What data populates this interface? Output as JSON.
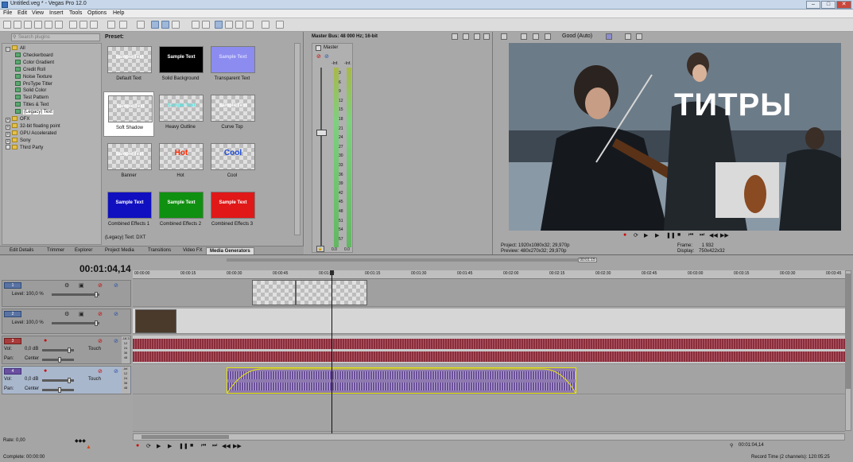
{
  "window": {
    "title": "Untitled.veg * - Vegas Pro 12.0",
    "controls": [
      "–",
      "□",
      "✕"
    ]
  },
  "menu": [
    "File",
    "Edit",
    "View",
    "Insert",
    "Tools",
    "Options",
    "Help"
  ],
  "explorer": {
    "search_placeholder": "Search plugins",
    "tree": [
      {
        "label": "All",
        "level": 0,
        "kind": "folder",
        "expander": "−"
      },
      {
        "label": "Checkerboard",
        "level": 1,
        "kind": "gen"
      },
      {
        "label": "Color Gradient",
        "level": 1,
        "kind": "gen"
      },
      {
        "label": "Credit Roll",
        "level": 1,
        "kind": "gen"
      },
      {
        "label": "Noise Texture",
        "level": 1,
        "kind": "gen"
      },
      {
        "label": "ProType Titler",
        "level": 1,
        "kind": "gen"
      },
      {
        "label": "Solid Color",
        "level": 1,
        "kind": "gen"
      },
      {
        "label": "Test Pattern",
        "level": 1,
        "kind": "gen"
      },
      {
        "label": "Titles & Text",
        "level": 1,
        "kind": "gen"
      },
      {
        "label": "(Legacy) Text",
        "level": 1,
        "kind": "gen",
        "selected": true
      },
      {
        "label": "OFX",
        "level": 0,
        "kind": "folder",
        "expander": "+"
      },
      {
        "label": "32-bit floating point",
        "level": 0,
        "kind": "folder",
        "expander": "+"
      },
      {
        "label": "GPU Accelerated",
        "level": 0,
        "kind": "folder",
        "expander": "+"
      },
      {
        "label": "Sony",
        "level": 0,
        "kind": "folder",
        "expander": "+"
      },
      {
        "label": "Third Party",
        "level": 0,
        "kind": "folder",
        "expander": ""
      }
    ],
    "preset_heading": "Preset:",
    "presets": [
      {
        "name": "Default Text",
        "thumb_text": "Sample Text",
        "bg": "checker",
        "fg": "#ffffff"
      },
      {
        "name": "Solid Background",
        "thumb_text": "Sample Text",
        "bg": "#000000",
        "fg": "#ffffff"
      },
      {
        "name": "Transparent Text",
        "thumb_text": "Sample Text",
        "bg": "#8c8cf0",
        "fg": "#d8d8ff"
      },
      {
        "name": "Soft Shadow",
        "thumb_text": "Sample Text",
        "bg": "checker",
        "fg": "#ffffff",
        "selected": true
      },
      {
        "name": "Heavy Outline",
        "thumb_text": "Sample Text",
        "bg": "checker",
        "fg": "#54e3e3"
      },
      {
        "name": "Curve Top",
        "thumb_text": "Sample Text",
        "bg": "checker",
        "fg": "#ffffff"
      },
      {
        "name": "Banner",
        "thumb_text": "Sample Text",
        "bg": "checker",
        "fg": "#ffffff"
      },
      {
        "name": "Hot",
        "thumb_text": "Hot",
        "bg": "checker",
        "fg": "#ff2a00"
      },
      {
        "name": "Cool",
        "thumb_text": "Cool",
        "bg": "checker",
        "fg": "#1d4bd8"
      },
      {
        "name": "Combined Effects 1",
        "thumb_text": "Sample Text",
        "bg": "#1010c0",
        "fg": "#ffffff"
      },
      {
        "name": "Combined Effects 2",
        "thumb_text": "Sample Text",
        "bg": "#109010",
        "fg": "#ffffff"
      },
      {
        "name": "Combined Effects 3",
        "thumb_text": "Sample Text",
        "bg": "#e01818",
        "fg": "#ffffff"
      }
    ],
    "status": "(Legacy) Text: DXT",
    "tabs": [
      "Edit Details",
      "Trimmer",
      "Explorer",
      "Project Media",
      "Transitions",
      "Video FX",
      "Media Generators"
    ],
    "active_tab": "Media Generators"
  },
  "master_bus": {
    "title": "Master Bus: 48 000 Hz; 16-bit",
    "channel": "Master",
    "peak_left": "-Inf.",
    "peak_right": "-Inf.",
    "scale": [
      "3",
      "6",
      "9",
      "12",
      "15",
      "18",
      "21",
      "24",
      "27",
      "30",
      "33",
      "36",
      "39",
      "42",
      "45",
      "48",
      "51",
      "54",
      "57"
    ],
    "bottom_left": "0.0",
    "bottom_right": "0.0"
  },
  "preview": {
    "quality": "Good (Auto)",
    "overlay_text": "ТИТРЫ",
    "project_label": "Project:",
    "project_value": "1920x1080x32; 29,970p",
    "preview_label": "Preview:",
    "preview_value": "480x270x32; 29,970p",
    "frame_label": "Frame:",
    "frame_value": "1 932",
    "display_label": "Display:",
    "display_value": "750x422x32"
  },
  "timeline": {
    "timecode": "00:01:04,14",
    "loop_tag": "00:01:15",
    "ruler": [
      "00:00:00",
      "00:00:15",
      "00:00:30",
      "00:00:45",
      "00:01:00",
      "00:01:15",
      "00:01:30",
      "00:01:45",
      "00:02:00",
      "00:02:15",
      "00:02:30",
      "00:02:45",
      "00:03:00",
      "00:03:15",
      "00:03:30",
      "00:03:45",
      "00:04:00"
    ],
    "tracks": [
      {
        "num": "1",
        "type": "video",
        "level_label": "Level: 100,0 %"
      },
      {
        "num": "2",
        "type": "video",
        "level_label": "Level: 100,0 %"
      },
      {
        "num": "3",
        "type": "audio",
        "vol_label": "Vol:",
        "vol_value": "0,0 dB",
        "pan_label": "Pan:",
        "pan_value": "Center",
        "mode": "Touch",
        "meter": [
          "-18.3",
          "12",
          "24",
          "36",
          "48"
        ]
      },
      {
        "num": "4",
        "type": "audio",
        "vol_label": "Vol:",
        "vol_value": "0,0 dB",
        "pan_label": "Pan:",
        "pan_value": "Center",
        "mode": "Touch",
        "meter": [
          "-Inf.",
          "12",
          "24",
          "36",
          "48"
        ]
      }
    ],
    "rate": "Rate: 0,00",
    "complete": "Complete: 00:00:00",
    "cursor_time": "00:01:04,14",
    "record_time": "Record Time (2 channels): 120:05:25"
  },
  "colors": {
    "selection": "#5e7fa8",
    "audio_wave": "#8a2d3a",
    "audio2_clip": "#8f7ab0",
    "envelope": "#e6e600"
  }
}
